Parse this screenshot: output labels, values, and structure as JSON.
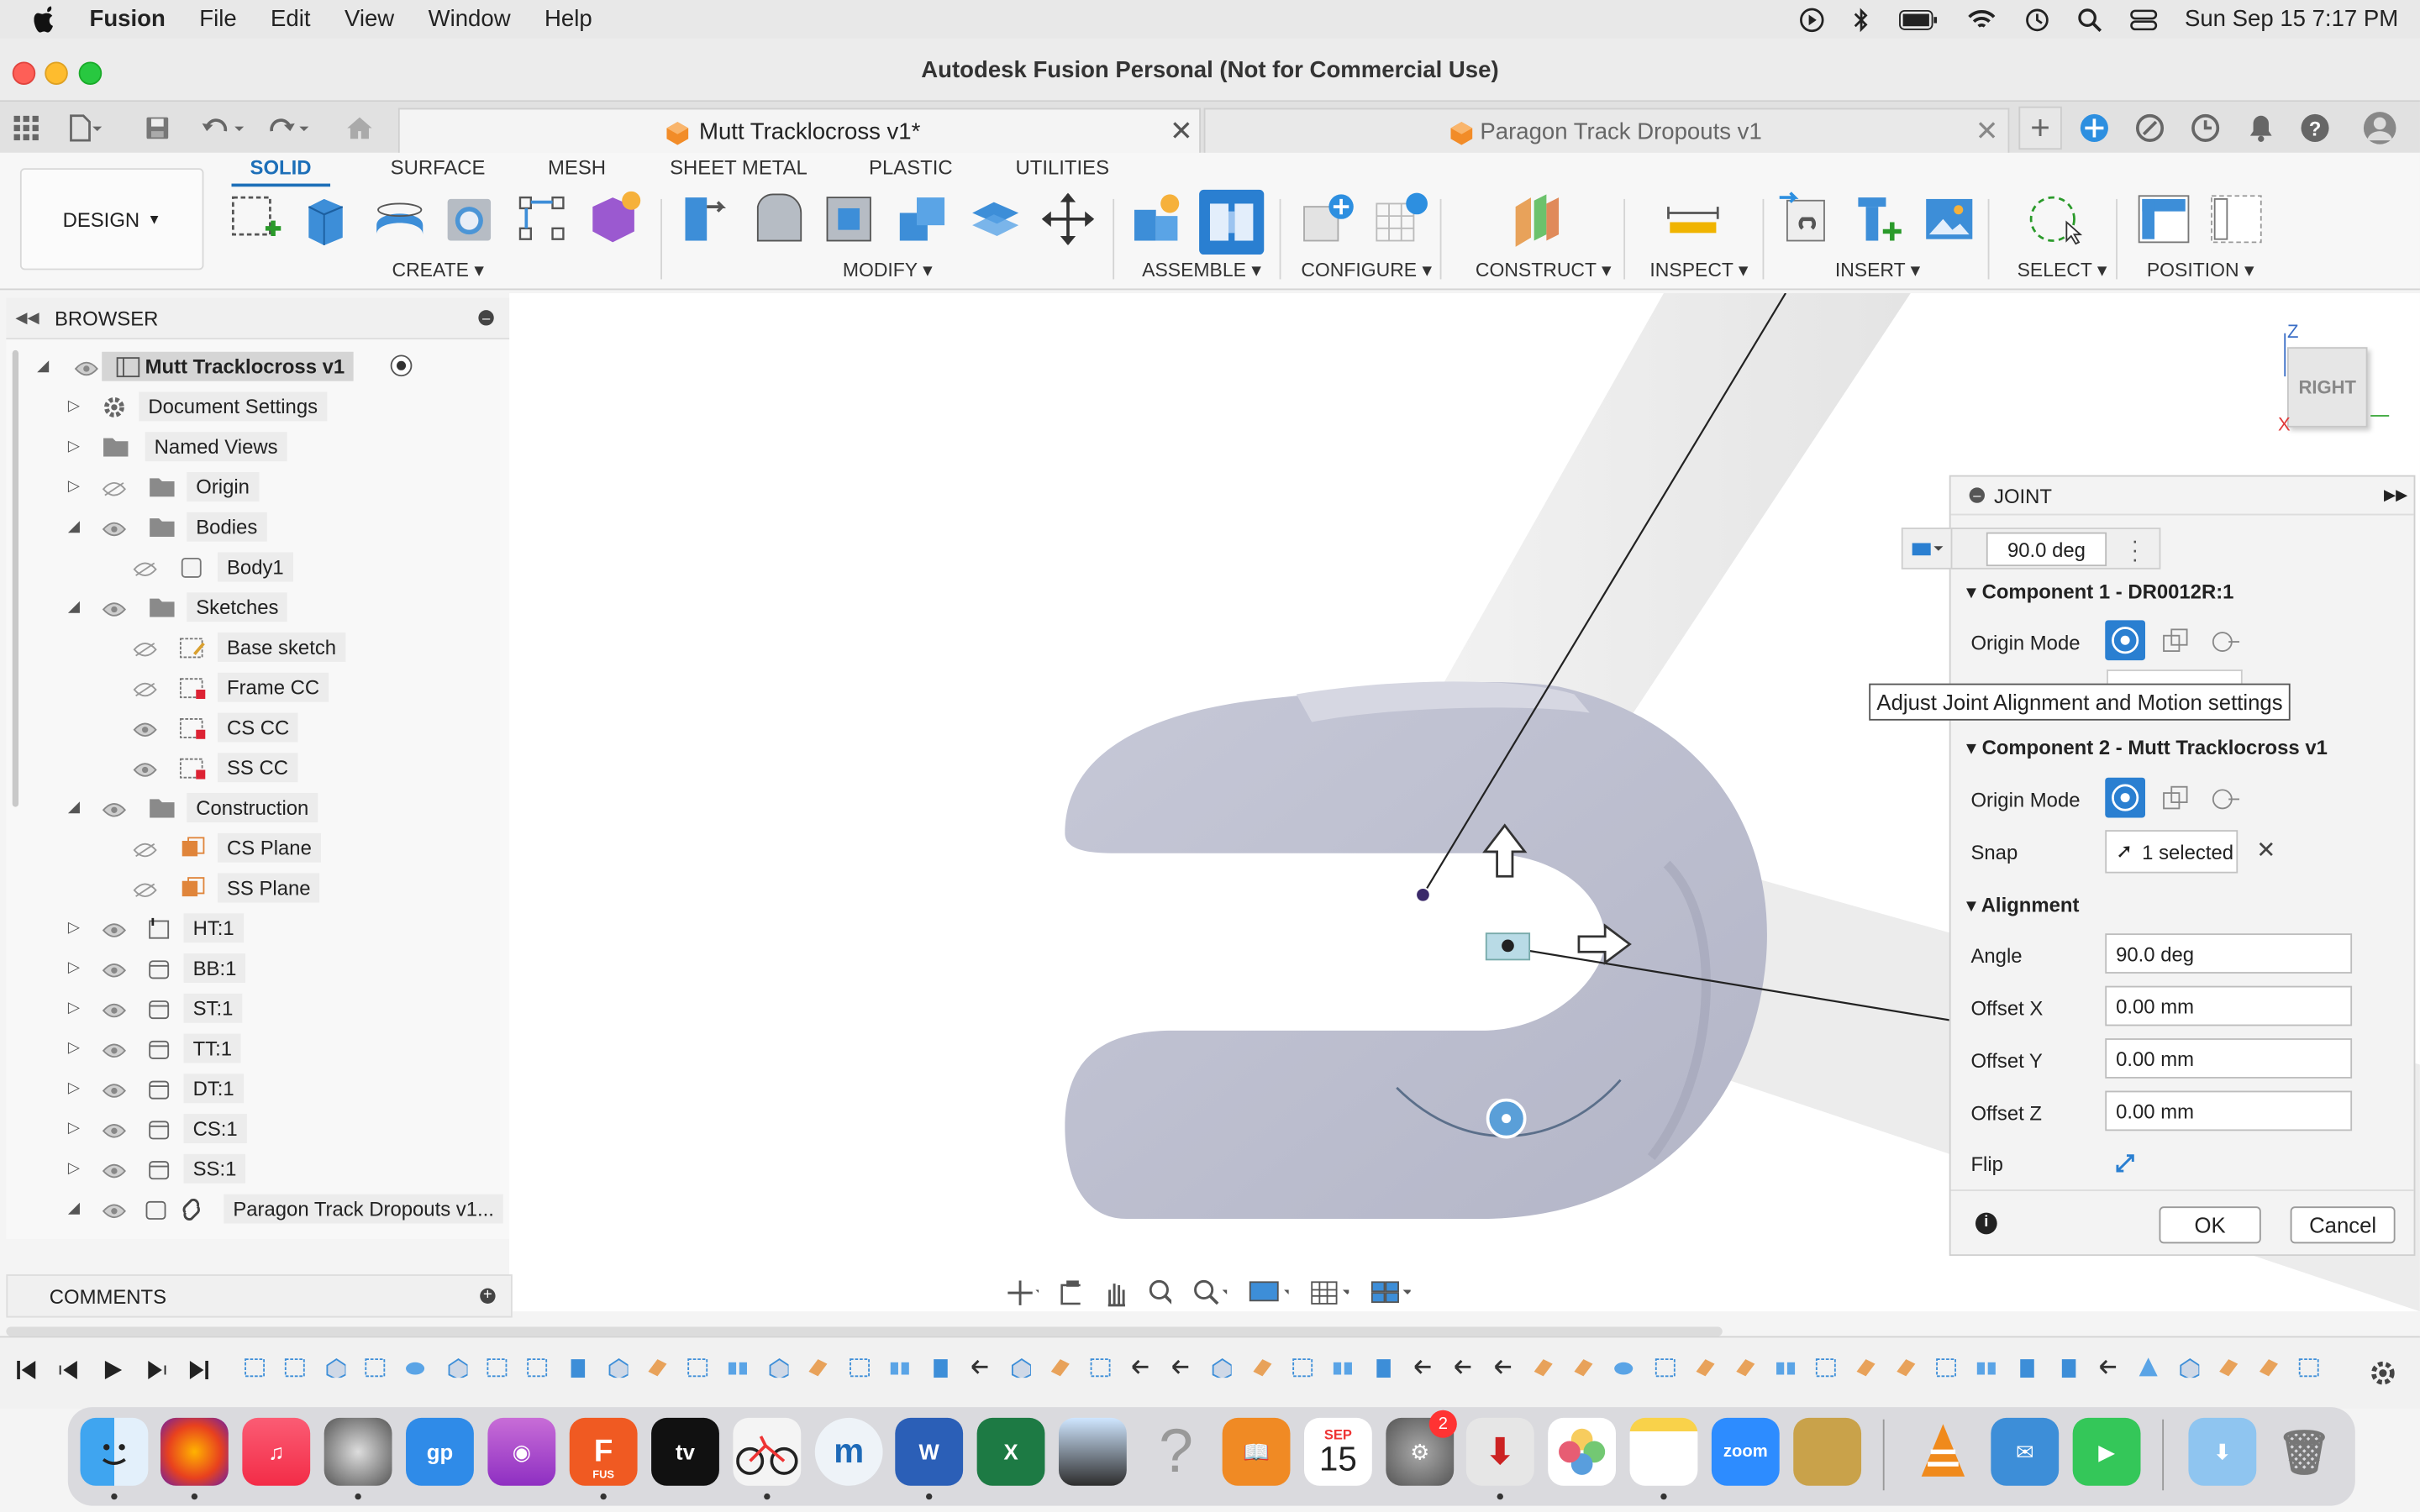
{
  "menubar": {
    "app": "Fusion",
    "items": [
      "File",
      "Edit",
      "View",
      "Window",
      "Help"
    ],
    "clock": "Sun Sep 15  7:17 PM"
  },
  "window": {
    "title": "Autodesk Fusion Personal (Not for Commercial Use)"
  },
  "tabs": [
    {
      "label": "Mutt Tracklocross v1*",
      "active": true
    },
    {
      "label": "Paragon Track Dropouts v1",
      "active": false
    }
  ],
  "ribbon": {
    "workspace": "DESIGN",
    "tabs": [
      "SOLID",
      "SURFACE",
      "MESH",
      "SHEET METAL",
      "PLASTIC",
      "UTILITIES"
    ],
    "groups": [
      "CREATE",
      "MODIFY",
      "ASSEMBLE",
      "CONFIGURE",
      "CONSTRUCT",
      "INSPECT",
      "INSERT",
      "SELECT",
      "POSITION"
    ]
  },
  "browser": {
    "title": "BROWSER",
    "root": "Mutt Tracklocross v1",
    "items": [
      {
        "label": "Document Settings"
      },
      {
        "label": "Named Views"
      },
      {
        "label": "Origin"
      },
      {
        "label": "Bodies"
      },
      {
        "label": "Body1"
      },
      {
        "label": "Sketches"
      },
      {
        "label": "Base sketch"
      },
      {
        "label": "Frame CC"
      },
      {
        "label": "CS CC"
      },
      {
        "label": "SS CC"
      },
      {
        "label": "Construction"
      },
      {
        "label": "CS Plane"
      },
      {
        "label": "SS Plane"
      },
      {
        "label": "HT:1"
      },
      {
        "label": "BB:1"
      },
      {
        "label": "ST:1"
      },
      {
        "label": "TT:1"
      },
      {
        "label": "DT:1"
      },
      {
        "label": "CS:1"
      },
      {
        "label": "SS:1"
      },
      {
        "label": "Paragon Track Dropouts v1..."
      }
    ],
    "comments": "COMMENTS"
  },
  "viewcube": {
    "face": "RIGHT",
    "axis_z": "Z",
    "axis_x": "X"
  },
  "joint": {
    "title": "JOINT",
    "top_angle": "90.0 deg",
    "component1": "Component 1 - DR0012R:1",
    "component2": "Component 2 - Mutt Tracklocross v1",
    "origin_mode_label": "Origin Mode",
    "snap_label": "Snap",
    "snap_value": "1 selected",
    "alignment_label": "Alignment",
    "angle_label": "Angle",
    "angle_value": "90.0 deg",
    "offset_x_label": "Offset X",
    "offset_x_value": "0.00 mm",
    "offset_y_label": "Offset Y",
    "offset_y_value": "0.00 mm",
    "offset_z_label": "Offset Z",
    "offset_z_value": "0.00 mm",
    "flip_label": "Flip",
    "ok": "OK",
    "cancel": "Cancel",
    "tooltip": "Adjust Joint Alignment and Motion settings"
  },
  "dock": {
    "calendar_month": "SEP",
    "calendar_day": "15",
    "settings_badge": "2",
    "zoom_label": "zoom",
    "fusion_label": "FUS"
  }
}
